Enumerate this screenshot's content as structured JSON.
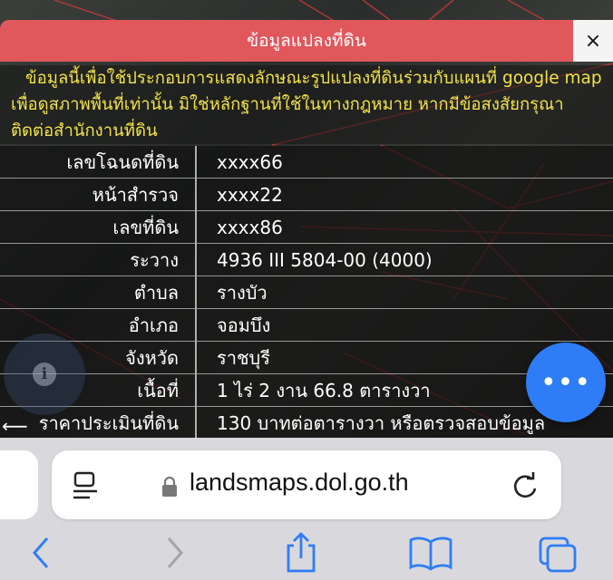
{
  "header": {
    "title": "ข้อมูลแปลงที่ดิน",
    "close_label": "×"
  },
  "notice": "ข้อมูลนี้เพื่อใช้ประกอบการแสดงลักษณะรูปแปลงที่ดินร่วมกับแผนที่ google map เพื่อดูสภาพพื้นที่เท่านั้น มิใช่หลักฐานที่ใช้ในทางกฎหมาย หากมีข้อสงสัยกรุณาติดต่อสำนักงานที่ดิน",
  "rows": [
    {
      "label": "เลขโฉนดที่ดิน",
      "value": "xxxx66"
    },
    {
      "label": "หน้าสำรวจ",
      "value": "xxxx22"
    },
    {
      "label": "เลขที่ดิน",
      "value": "xxxx86"
    },
    {
      "label": "ระวาง",
      "value": "4936 III 5804-00 (4000)"
    },
    {
      "label": "ตำบล",
      "value": "รางบัว"
    },
    {
      "label": "อำเภอ",
      "value": "จอมบึง"
    },
    {
      "label": "จังหวัด",
      "value": "ราชบุรี"
    },
    {
      "label": "เนื้อที่",
      "value": "1 ไร่ 2 งาน 66.8 ตารางวา"
    },
    {
      "label": "ราคาประเมินที่ดิน",
      "value": "130 บาทต่อตารางวา หรือตรวจสอบข้อมูล"
    }
  ],
  "fab_label": "•••",
  "info_label": "i",
  "back_arrow": "⟵",
  "safari": {
    "url": "landsmaps.dol.go.th"
  },
  "icons": {
    "reader": "reader-icon",
    "lock": "lock-icon",
    "reload": "reload-icon",
    "back": "chevron-left-icon",
    "forward": "chevron-right-icon",
    "share": "share-icon",
    "bookmarks": "book-icon",
    "tabs": "tabs-icon"
  },
  "colors": {
    "header": "#e0575c",
    "notice_text": "#f2e24a",
    "fab": "#2f7df6",
    "safari_accent": "#2f7df6"
  }
}
